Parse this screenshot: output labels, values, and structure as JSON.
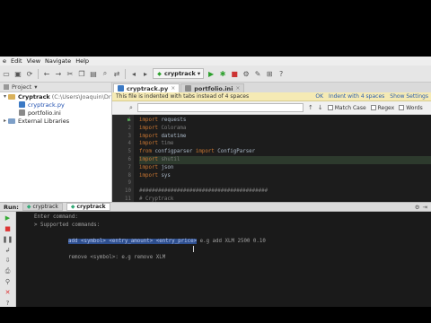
{
  "menu": [
    "e",
    "Edit",
    "View",
    "Navigate",
    "Help"
  ],
  "toolbar": {
    "run_config": "cryptrack"
  },
  "project": {
    "header": "Project",
    "root_name": "Cryptrack",
    "root_path": "(C:\\Users\\Joaquin\\Dr",
    "files": [
      "cryptrack.py",
      "portfolio.ini"
    ],
    "external": "External Libraries"
  },
  "editor": {
    "tabs": [
      {
        "label": "cryptrack.py",
        "close": "×"
      },
      {
        "label": "portfolio.ini",
        "close": "×"
      }
    ],
    "banner_text": "This file is indented with tabs instead of 4 spaces",
    "banner_links": [
      "OK",
      "Indent with 4 spaces",
      "Show Settings"
    ],
    "find_options": [
      "Match Case",
      "Regex",
      "Words"
    ],
    "line_numbers": [
      "1",
      "2",
      "3",
      "4",
      "5",
      "6",
      "7",
      "8",
      "9",
      "10",
      "11"
    ],
    "code_lines": [
      {
        "kw": "import",
        "rest": " requests"
      },
      {
        "kw": "import",
        "rest": " Colorama"
      },
      {
        "kw": "import",
        "rest": " datetime"
      },
      {
        "kw": "import",
        "rest": " time"
      },
      {
        "kw": "from",
        "rest": " configparser ",
        "kw2": "import",
        "rest2": " ConfigParser"
      },
      {
        "kw": "import",
        "rest": " shutil"
      },
      {
        "kw": "import",
        "rest": " json"
      },
      {
        "kw": "import",
        "rest": " sys"
      },
      {
        "kw": "",
        "rest": ""
      },
      {
        "kw": "",
        "rest": "#########################################"
      },
      {
        "kw": "",
        "rest": "# Cryptrack"
      }
    ]
  },
  "run": {
    "label": "Run:",
    "tabs": [
      "cryptrack",
      "cryptrack"
    ],
    "console": {
      "line1": "Enter command:",
      "line2": "> Supported commands:",
      "add_selected": "add <symbol> <entry_amount> <entry_price>",
      "add_rest": " e.g add XLM 2500 0.10",
      "remove": "remove <symbol>: e.g remove XLM"
    }
  }
}
